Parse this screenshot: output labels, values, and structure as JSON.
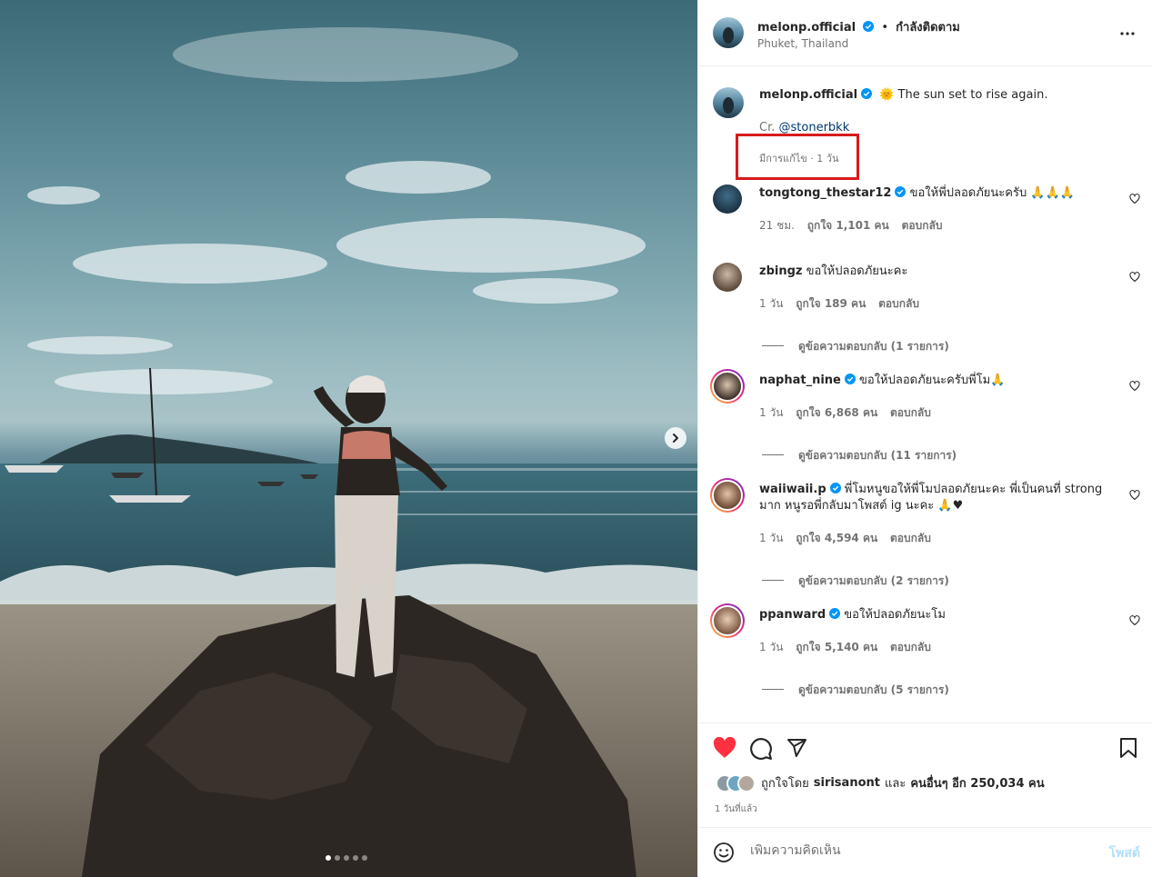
{
  "post": {
    "username": "melonp.official",
    "follow_separator": "•",
    "follow_status": "กำลังติดตาม",
    "location": "Phuket, Thailand",
    "caption_emoji": "🌞",
    "caption": "The sun set to rise again.",
    "credit_prefix": "Cr.",
    "credit_mention": "@stonerbkk",
    "edited_meta": "มีการแก้ไข · 1 วัน"
  },
  "carousel": {
    "slide_count": 5,
    "active_index": 0
  },
  "comments": [
    {
      "username": "tongtong_thestar12",
      "verified": true,
      "text": "ขอให้พี่ปลอดภัยนะครับ 🙏🙏🙏",
      "time": "21 ชม.",
      "likes": "ถูกใจ 1,101 คน",
      "reply": "ตอบกลับ",
      "view_replies": ""
    },
    {
      "username": "zbingz",
      "verified": false,
      "text": "ขอให้ปลอดภัยนะคะ",
      "time": "1 วัน",
      "likes": "ถูกใจ 189 คน",
      "reply": "ตอบกลับ",
      "view_replies": "ดูข้อความตอบกลับ (1 รายการ)"
    },
    {
      "username": "naphat_nine",
      "verified": true,
      "text": "ขอให้ปลอดภัยนะครับพี่โม🙏",
      "time": "1 วัน",
      "likes": "ถูกใจ 6,868 คน",
      "reply": "ตอบกลับ",
      "view_replies": "ดูข้อความตอบกลับ (11 รายการ)"
    },
    {
      "username": "waiiwaii.p",
      "verified": true,
      "text": "พี่โมหนูขอให้พี่โมปลอดภัยนะคะ พี่เป็นคนที่ strong มาก หนูรอพี่กลับมาโพสต์ ig นะคะ 🙏♥",
      "time": "1 วัน",
      "likes": "ถูกใจ 4,594 คน",
      "reply": "ตอบกลับ",
      "view_replies": "ดูข้อความตอบกลับ (2 รายการ)"
    },
    {
      "username": "ppanward",
      "verified": true,
      "text": "ขอให้ปลอดภัยนะโม",
      "time": "1 วัน",
      "likes": "ถูกใจ 5,140 คน",
      "reply": "ตอบกลับ",
      "view_replies": "ดูข้อความตอบกลับ (5 รายการ)"
    }
  ],
  "likes": {
    "prefix": "ถูกใจโดย",
    "user": "sirisanont",
    "and": "และ",
    "others": "คนอื่นๆ อีก 250,034 คน"
  },
  "posted_ago": "1 วันที่แล้ว",
  "add_comment": {
    "placeholder": "เพิ่มความคิดเห็น",
    "post_label": "โพสต์"
  },
  "colors": {
    "liked_heart": "#ff3040",
    "verified": "#0095f6",
    "highlight_box": "#d81b1b",
    "post_button_disabled": "#b2dffc"
  }
}
